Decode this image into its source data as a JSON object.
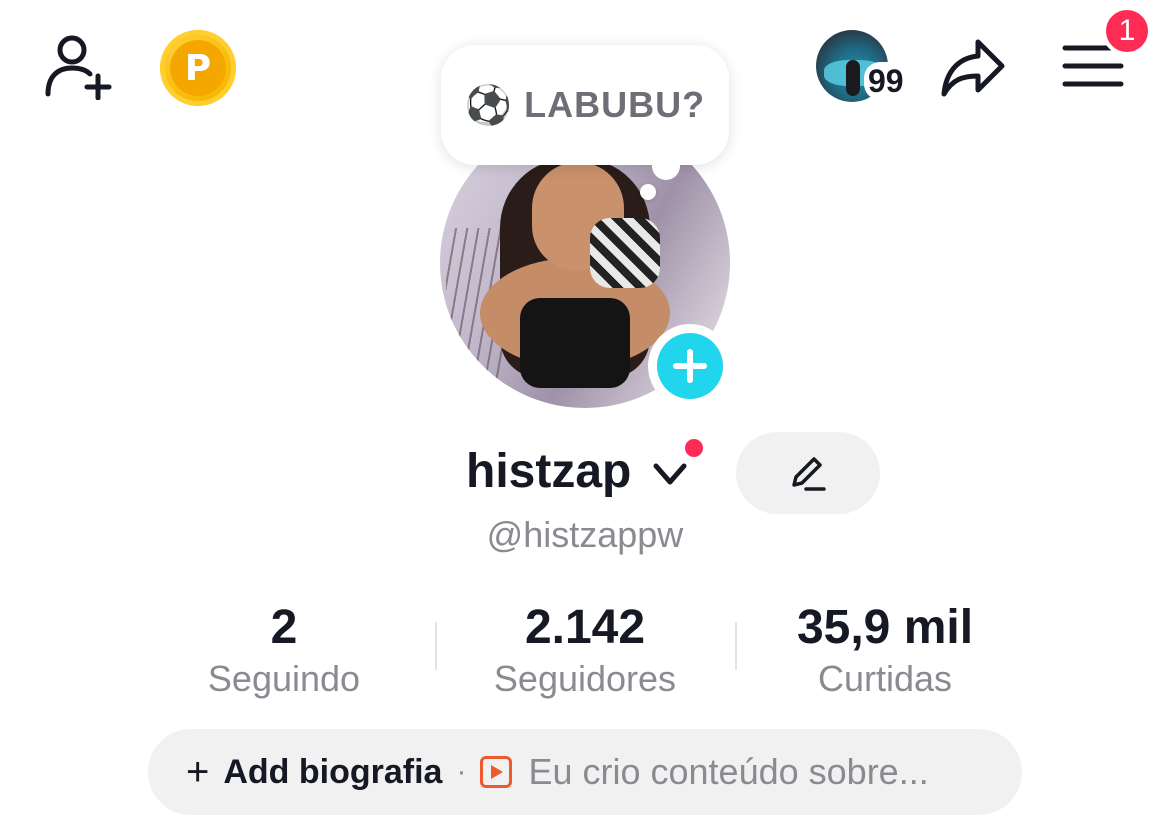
{
  "topbar": {
    "coin_letter": "P",
    "story_count": "99",
    "notification_count": "1"
  },
  "bubble": {
    "emoji": "⚽",
    "text": "LABUBU?"
  },
  "profile": {
    "username": "histzap",
    "handle": "@histzappw"
  },
  "stats": [
    {
      "value": "2",
      "label": "Seguindo"
    },
    {
      "value": "2.142",
      "label": "Seguidores"
    },
    {
      "value": "35,9 mil",
      "label": "Curtidas"
    }
  ],
  "bio": {
    "plus": "+",
    "add_label": "Add biografia",
    "separator": "·",
    "suggestion": "Eu crio conteúdo sobre..."
  },
  "colors": {
    "accent_red": "#fe2c55",
    "accent_cyan": "#20d5ec",
    "coin_gold": "#f5a700",
    "secondary_text": "#8a8b91"
  }
}
